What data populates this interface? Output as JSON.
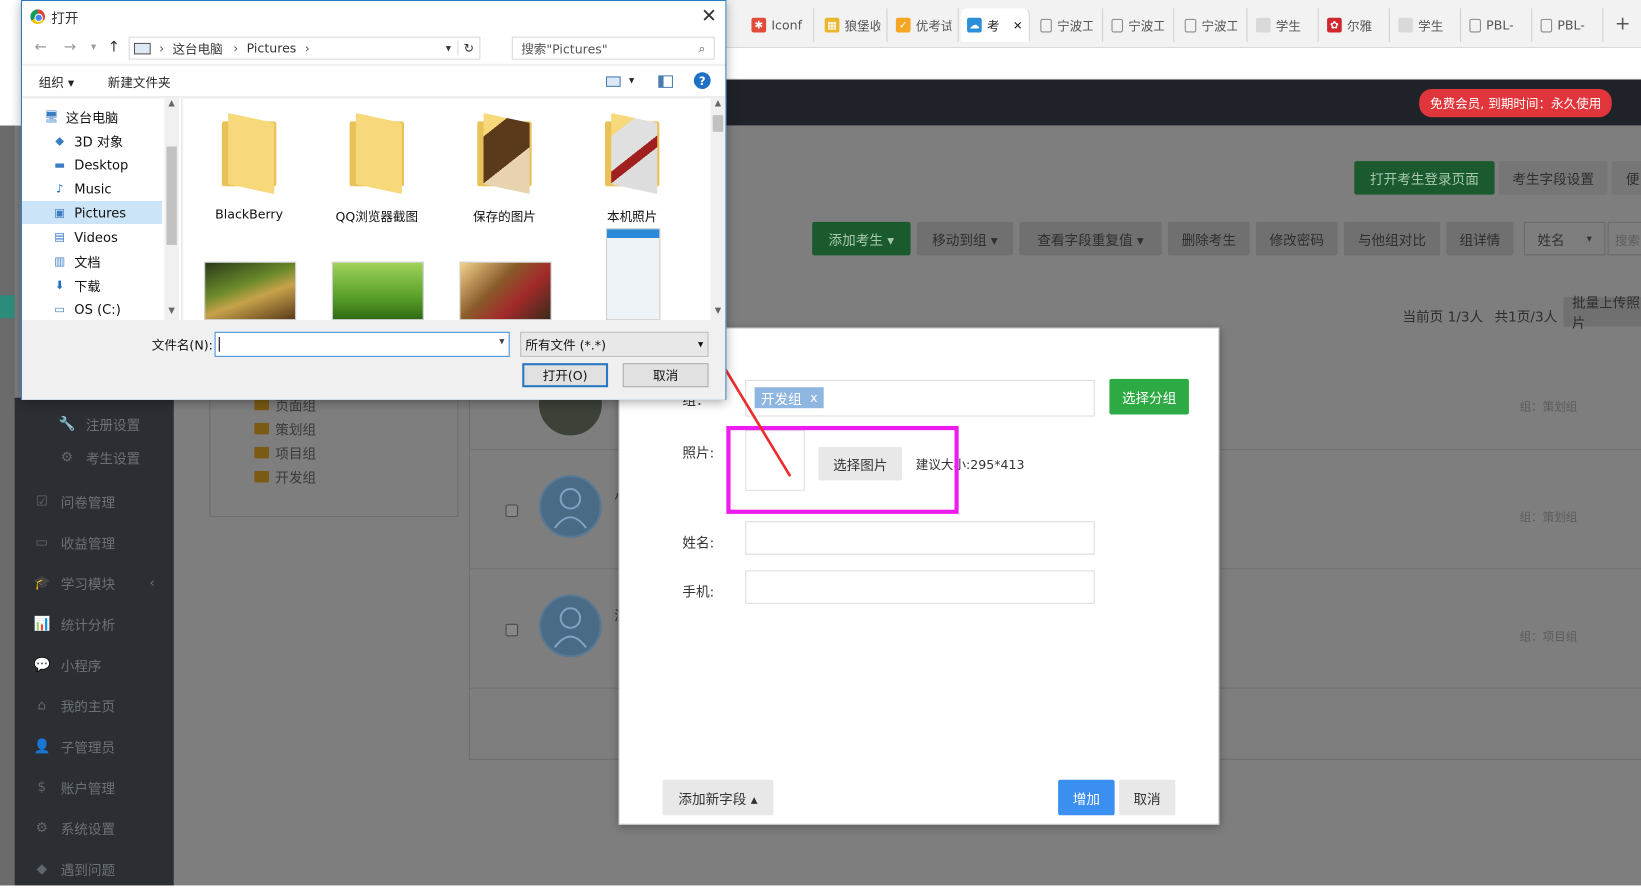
{
  "browser": {
    "tabs": [
      {
        "label": "Iconf",
        "color": "#e14b3b",
        "glyph": "✱",
        "icon": "iconfont-icon"
      },
      {
        "label": "狼堡收",
        "color": "#e7b62b",
        "glyph": "▦",
        "icon": "grid-icon"
      },
      {
        "label": "优考试",
        "color": "#f5a623",
        "glyph": "✓",
        "icon": "youkaoshi-icon"
      },
      {
        "label": "考",
        "color": "#2a8fd8",
        "glyph": "☁",
        "icon": "cloud-icon",
        "active": true
      },
      {
        "label": "宁波工",
        "color": "",
        "glyph": "▢",
        "icon": "page-icon"
      },
      {
        "label": "宁波工",
        "color": "",
        "glyph": "▢",
        "icon": "page-icon"
      },
      {
        "label": "宁波工",
        "color": "",
        "glyph": "▢",
        "icon": "page-icon"
      },
      {
        "label": "学生",
        "color": "#d9d9d9",
        "glyph": "",
        "icon": "blank-icon"
      },
      {
        "label": "尔雅",
        "color": "#d0262d",
        "glyph": "✿",
        "icon": "erya-icon"
      },
      {
        "label": "学生",
        "color": "#d9d9d9",
        "glyph": "",
        "icon": "blank-icon"
      },
      {
        "label": "PBL-",
        "color": "",
        "glyph": "▢",
        "icon": "page-icon"
      },
      {
        "label": "PBL-",
        "color": "",
        "glyph": "▢",
        "icon": "page-icon"
      }
    ],
    "close_glyph": "✕",
    "newtab_glyph": "+"
  },
  "app": {
    "vip_badge": "免费会员, 到期时间：永久使用",
    "top_buttons": {
      "open_login": "打开考生登录页面",
      "field_settings": "考生字段设置",
      "more": "便"
    },
    "toolbar": {
      "add_examinee": "添加考生 ▾",
      "move_group": "移动到组 ▾",
      "check_dup": "查看字段重复值 ▾",
      "delete": "删除考生",
      "change_pw": "修改密码",
      "compare": "与他组对比",
      "group_detail": "组详情",
      "search_field": "姓名",
      "search_placeholder": "搜索"
    },
    "pageinfo": {
      "current": "当前页 1/3人",
      "total": "共1页/3人",
      "batch": "批量上传照片"
    },
    "groups": [
      "页面组",
      "策划组",
      "项目组",
      "开发组"
    ],
    "sidebar": [
      {
        "label": "注册设置",
        "glyph": "🔧",
        "icon": "wrench-icon",
        "sub": true
      },
      {
        "label": "考生设置",
        "glyph": "⚙",
        "icon": "gear-icon",
        "sub": true
      },
      {
        "label": "问卷管理",
        "glyph": "☑",
        "icon": "checkbox-icon"
      },
      {
        "label": "收益管理",
        "glyph": "▭",
        "icon": "card-icon"
      },
      {
        "label": "学习模块",
        "glyph": "🎓",
        "icon": "graduation-icon",
        "chev": "‹"
      },
      {
        "label": "统计分析",
        "glyph": "📊",
        "icon": "chart-icon"
      },
      {
        "label": "小程序",
        "glyph": "💬",
        "icon": "wechat-icon"
      },
      {
        "label": "我的主页",
        "glyph": "⌂",
        "icon": "home-icon"
      },
      {
        "label": "子管理员",
        "glyph": "👤",
        "icon": "user-icon"
      },
      {
        "label": "账户管理",
        "glyph": "$",
        "icon": "dollar-icon"
      },
      {
        "label": "系统设置",
        "glyph": "⚙",
        "icon": "settings-icon"
      },
      {
        "label": "遇到问题",
        "glyph": "◆",
        "icon": "help-icon"
      }
    ],
    "rows": [
      {
        "group": "组：策划组"
      },
      {
        "group": "组：策划组",
        "name_initial": "小"
      },
      {
        "group": "组：项目组",
        "name_initial": "测"
      }
    ]
  },
  "modal": {
    "group_label": "组：",
    "group_tag": "开发组",
    "tag_remove": "x",
    "select_group": "选择分组",
    "photo_label": "照片:",
    "choose_image": "选择图片",
    "hint": "建议大小:295*413",
    "name_label": "姓名:",
    "phone_label": "手机:",
    "add_field": "添加新字段 ▴",
    "submit": "增加",
    "cancel": "取消"
  },
  "dialog": {
    "title": "打开",
    "path": [
      "这台电脑",
      "Pictures"
    ],
    "search_placeholder": "搜索\"Pictures\"",
    "organize": "组织 ▾",
    "new_folder": "新建文件夹",
    "nav": [
      {
        "label": "这台电脑",
        "glyph": "🖥",
        "icon": "computer-icon",
        "indent": 0
      },
      {
        "label": "3D 对象",
        "glyph": "◆",
        "icon": "cube-icon",
        "indent": 1
      },
      {
        "label": "Desktop",
        "glyph": "▬",
        "icon": "desktop-icon",
        "indent": 1
      },
      {
        "label": "Music",
        "glyph": "♪",
        "icon": "music-icon",
        "indent": 1
      },
      {
        "label": "Pictures",
        "glyph": "▣",
        "icon": "pictures-icon",
        "indent": 1,
        "selected": true
      },
      {
        "label": "Videos",
        "glyph": "▤",
        "icon": "videos-icon",
        "indent": 1
      },
      {
        "label": "文档",
        "glyph": "▥",
        "icon": "documents-icon",
        "indent": 1
      },
      {
        "label": "下载",
        "glyph": "⬇",
        "icon": "download-icon",
        "indent": 1
      },
      {
        "label": "OS (C:)",
        "glyph": "▭",
        "icon": "drive-icon",
        "indent": 1
      }
    ],
    "folders": [
      "BlackBerry",
      "QQ浏览器截图",
      "保存的图片",
      "本机照片"
    ],
    "filename_label": "文件名(N):",
    "filename_value": "",
    "filetype": "所有文件 (*.*)",
    "open": "打开(O)",
    "cancel": "取消"
  },
  "colors": {
    "highlight": "#ee1cee",
    "arrow": "#ee2a2a",
    "green": "#2eaa44",
    "blue": "#3a8ff0"
  }
}
